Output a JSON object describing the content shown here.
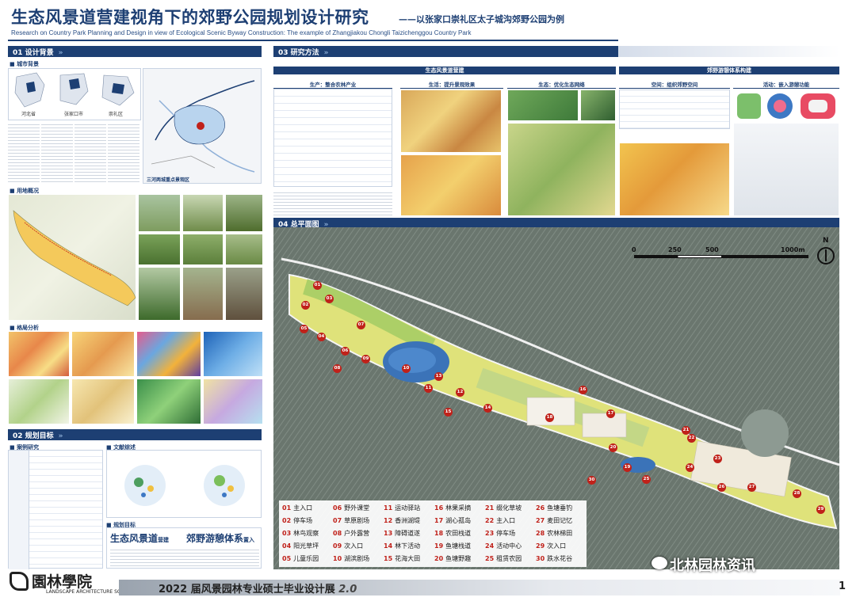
{
  "header": {
    "title": "生态风景道营建视角下的郊野公园规划设计研究",
    "title_sub": "——以张家口崇礼区太子城沟郊野公园为例",
    "subtitle_en": "Research on Country Park Planning and Design in view of Ecological Scenic Byway Construction: The example of Zhangjiakou Chongli Taizichenggou Country Park"
  },
  "sections": {
    "background": "01 设计背景",
    "goals": "02 规划目标",
    "methods": "03 研究方法",
    "plan": "04 总平面图"
  },
  "background": {
    "city_bg": "城市背景",
    "maps": [
      "河北省",
      "张家口市",
      "崇礼区"
    ],
    "region_label": "三河两城重点景观区",
    "site": "用地概况",
    "pattern": "格局分析"
  },
  "goals": {
    "case_study": "案例研究",
    "literature": "文献综述",
    "planning_goal": "规划目标",
    "goal_a": "生态风景道",
    "goal_a_tail": "营建",
    "goal_b": "郊野游憩体系",
    "goal_b_tail": "置入"
  },
  "methods": {
    "bar_left": "生态风景道营建",
    "bar_right": "郊野游憩体系构建",
    "sub1": "生产：整合农林产业",
    "sub2": "生活：提升景观效果",
    "sub3": "生态：优化生态网络",
    "sub4": "空间：组织郊野空间",
    "sub5": "活动：嵌入游憩功能"
  },
  "plan": {
    "scale_labels": [
      "0",
      "250",
      "500",
      "1000m"
    ],
    "north": "N",
    "legend": [
      {
        "n": "01",
        "t": "主入口"
      },
      {
        "n": "02",
        "t": "停车场"
      },
      {
        "n": "03",
        "t": "林鸟观察"
      },
      {
        "n": "04",
        "t": "阳光草坪"
      },
      {
        "n": "05",
        "t": "儿童乐园"
      },
      {
        "n": "06",
        "t": "野外课堂"
      },
      {
        "n": "07",
        "t": "草原剧场"
      },
      {
        "n": "08",
        "t": "户外露营"
      },
      {
        "n": "09",
        "t": "次入口"
      },
      {
        "n": "10",
        "t": "湖滨剧场"
      },
      {
        "n": "11",
        "t": "运动驿站"
      },
      {
        "n": "12",
        "t": "香洲湖堤"
      },
      {
        "n": "13",
        "t": "障碍道遂"
      },
      {
        "n": "14",
        "t": "林下活动"
      },
      {
        "n": "15",
        "t": "花海大田"
      },
      {
        "n": "16",
        "t": "林果采摘"
      },
      {
        "n": "17",
        "t": "湖心孤岛"
      },
      {
        "n": "18",
        "t": "农田栈道"
      },
      {
        "n": "19",
        "t": "鱼塘栈道"
      },
      {
        "n": "20",
        "t": "鱼塘野趣"
      },
      {
        "n": "21",
        "t": "缀化草坡"
      },
      {
        "n": "22",
        "t": "主入口"
      },
      {
        "n": "23",
        "t": "停车场"
      },
      {
        "n": "24",
        "t": "活动中心"
      },
      {
        "n": "25",
        "t": "租赁农园"
      },
      {
        "n": "26",
        "t": "鱼塘垂钓"
      },
      {
        "n": "27",
        "t": "麦田记忆"
      },
      {
        "n": "28",
        "t": "农林梯田"
      },
      {
        "n": "29",
        "t": "次入口"
      },
      {
        "n": "30",
        "t": "跌水花谷"
      }
    ]
  },
  "footer": {
    "logo": "園林學院",
    "logo_en": "LANDSCAPE ARCHITECTURE SCHOOL",
    "exhibition": "2022 届风景园林专业硕士毕业设计展",
    "badge": "2.0",
    "page": "1",
    "watermark": "北林园林资讯"
  },
  "colors": {
    "navy": "#1d3f73",
    "accent_red": "#c0211a"
  }
}
